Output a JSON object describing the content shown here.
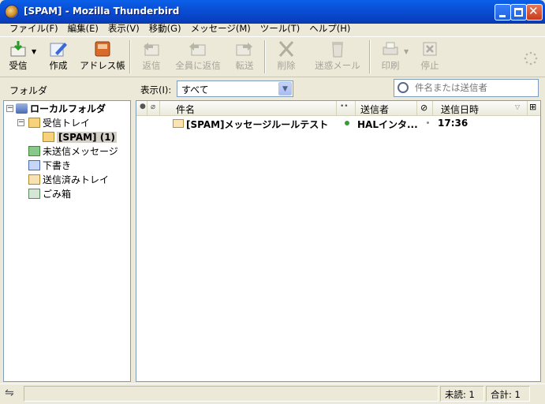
{
  "window": {
    "title": "[SPAM] - Mozilla Thunderbird"
  },
  "menu": [
    "ファイル(F)",
    "編集(E)",
    "表示(V)",
    "移動(G)",
    "メッセージ(M)",
    "ツール(T)",
    "ヘルプ(H)"
  ],
  "toolbar": {
    "get_mail": "受信",
    "compose": "作成",
    "address_book": "アドレス帳",
    "reply": "返信",
    "reply_all": "全員に返信",
    "forward": "転送",
    "delete": "削除",
    "junk": "迷惑メール",
    "print": "印刷",
    "stop": "停止"
  },
  "folder_pane": {
    "header": "フォルダ",
    "tree": [
      "ローカルフォルダ",
      "受信トレイ",
      "[SPAM] (1)",
      "未送信メッセージ",
      "下書き",
      "送信済みトレイ",
      "ごみ箱"
    ]
  },
  "view_bar": {
    "label": "表示(I):",
    "selected": "すべて",
    "search_placeholder": "件名または送信者"
  },
  "thread_columns": {
    "subject": "件名",
    "sender": "送信者",
    "date": "送信日時"
  },
  "messages": [
    {
      "subject": "[SPAM]メッセージルールテスト",
      "sender": "HALインタ...",
      "date": "17:36"
    }
  ],
  "status": {
    "unread": "未読: 1",
    "total": "合計: 1"
  }
}
